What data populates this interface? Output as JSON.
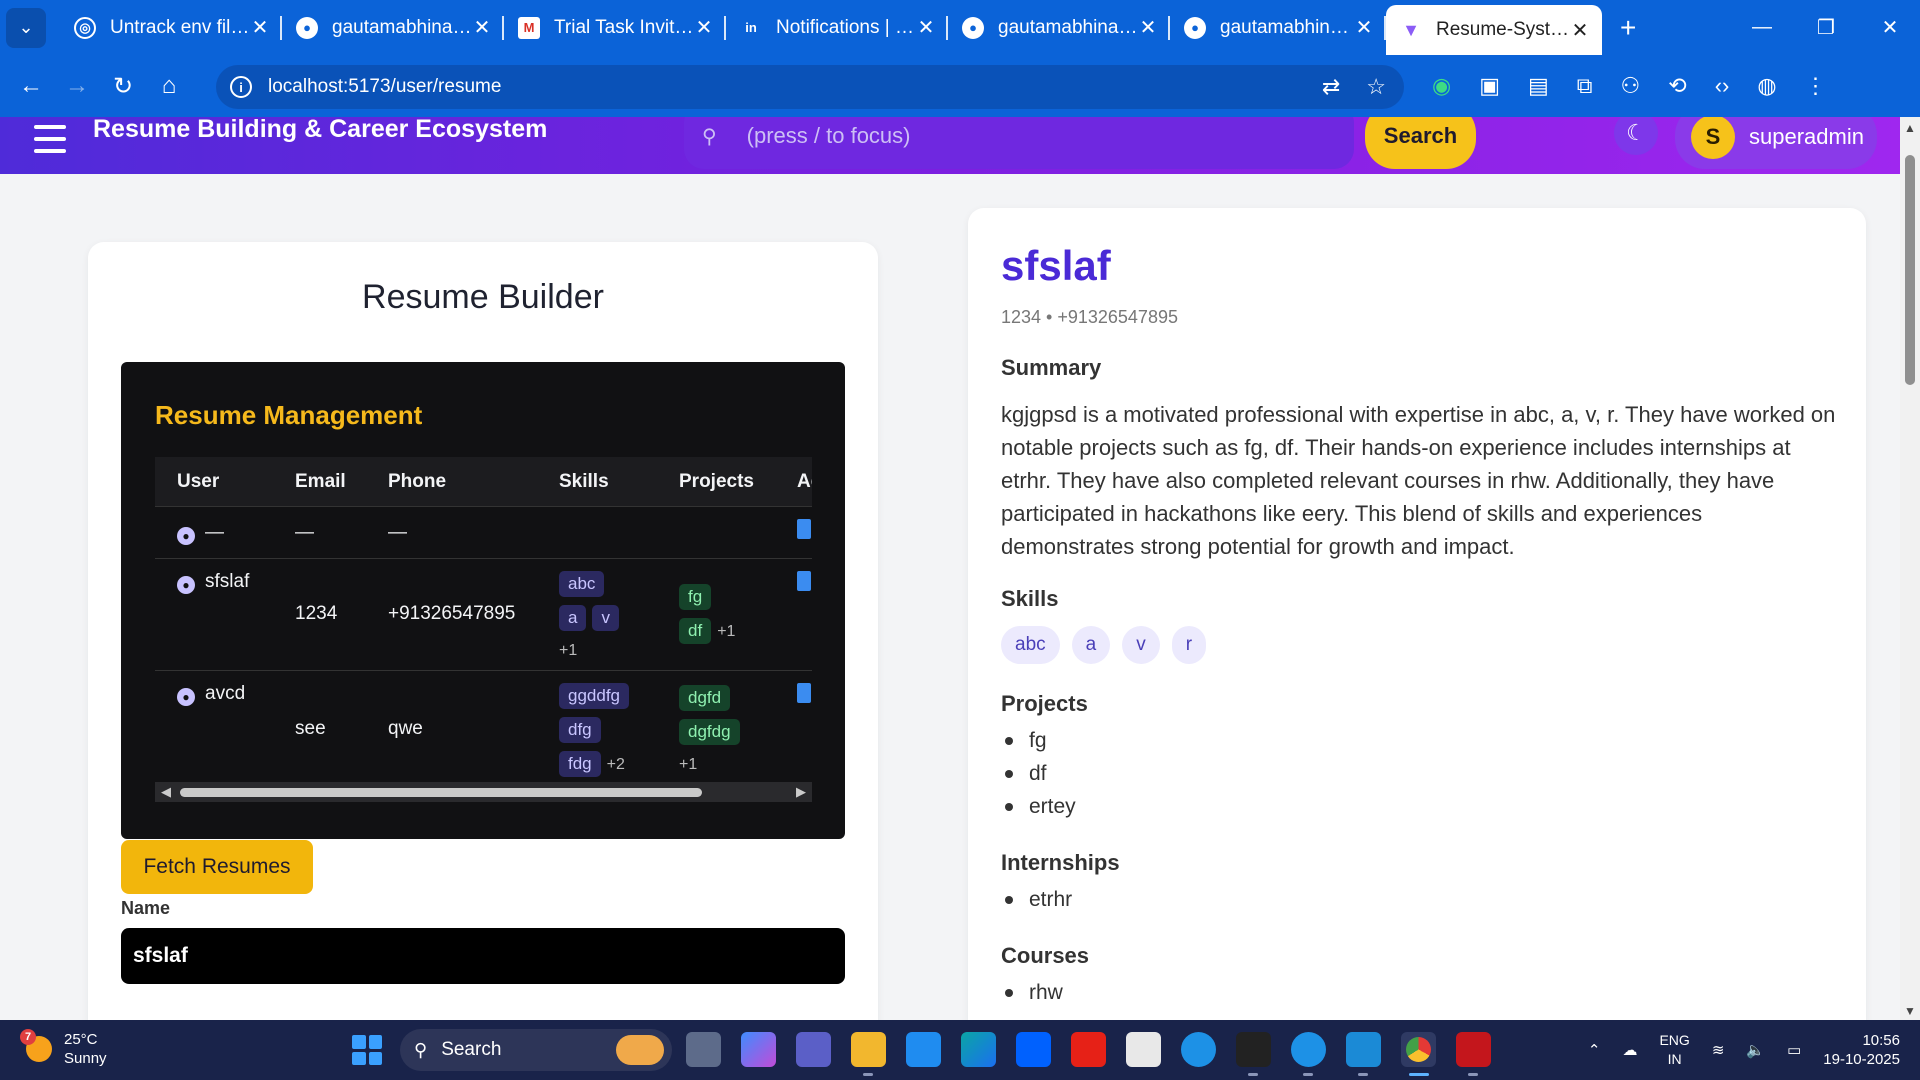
{
  "browser": {
    "tabs": [
      {
        "label": "Untrack env files",
        "icon": "openai-icon"
      },
      {
        "label": "gautamabhinav/R",
        "icon": "github-icon"
      },
      {
        "label": "Trial Task Invitatio",
        "icon": "gmail-icon"
      },
      {
        "label": "Notifications | Lin",
        "icon": "linkedin-icon"
      },
      {
        "label": "gautamabhinav/R",
        "icon": "github-icon"
      },
      {
        "label": "gautamabhinav/R",
        "icon": "github-icon"
      },
      {
        "label": "Resume-System",
        "icon": "vite-icon",
        "active": true
      }
    ],
    "url": "localhost:5173/user/resume"
  },
  "app": {
    "title": "Resume Building & Career Ecosystem",
    "search_placeholder": "(press / to focus)",
    "search_button": "Search",
    "user_initial": "S",
    "user_name": "superadmin",
    "accent": "#6a2be0"
  },
  "builder": {
    "title": "Resume Builder",
    "management_title": "Resume Management",
    "columns": [
      "User",
      "Email",
      "Phone",
      "Skills",
      "Projects",
      "Ac"
    ],
    "rows": [
      {
        "user": "—",
        "email": "—",
        "phone": "—",
        "skills": [],
        "skills_more": "",
        "projects": [],
        "projects_more": ""
      },
      {
        "user": "sfslaf",
        "email": "1234",
        "phone": "+91326547895",
        "skills": [
          "abc",
          "a",
          "v"
        ],
        "skills_more": "+1",
        "projects": [
          "fg",
          "df"
        ],
        "projects_more": "+1"
      },
      {
        "user": "avcd",
        "email": "see",
        "phone": "qwe",
        "skills": [
          "ggddfg",
          "dfg",
          "fdg"
        ],
        "skills_more": "+2",
        "projects": [
          "dgfd",
          "dgfdg"
        ],
        "projects_more": "+1"
      }
    ],
    "fetch_button": "Fetch Resumes",
    "name_label": "Name",
    "name_value": "sfslaf"
  },
  "preview": {
    "name": "sfslaf",
    "contact": "1234 • +91326547895",
    "summary_heading": "Summary",
    "summary": "kgjgpsd is a motivated professional with expertise in abc, a, v, r. They have worked on notable projects such as fg, df. Their hands-on experience includes internships at etrhr. They have also completed relevant courses in rhw. Additionally, they have participated in hackathons like eery. This blend of skills and experiences demonstrates strong potential for growth and impact.",
    "skills_heading": "Skills",
    "skills": [
      "abc",
      "a",
      "v",
      "r"
    ],
    "projects_heading": "Projects",
    "projects": [
      "fg",
      "df",
      "ertey"
    ],
    "internships_heading": "Internships",
    "internships": [
      "etrhr"
    ],
    "courses_heading": "Courses",
    "courses": [
      "rhw"
    ]
  },
  "taskbar": {
    "weather_badge": "7",
    "temperature": "25°C",
    "condition": "Sunny",
    "search_label": "Search",
    "lang_1": "ENG",
    "lang_2": "IN",
    "time": "10:56",
    "date": "19-10-2025"
  }
}
